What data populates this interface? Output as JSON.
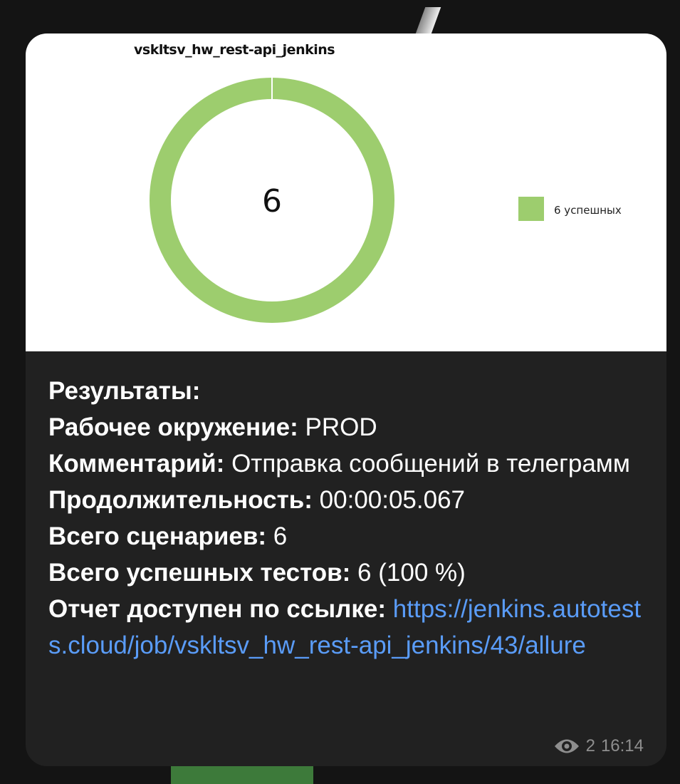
{
  "message": {
    "lines": [
      {
        "label": "Результаты:",
        "value": ""
      },
      {
        "label": "Рабочее окружение:",
        "value": " PROD"
      },
      {
        "label": "Комментарий:",
        "value": " Отправка сообщений в телеграмм"
      },
      {
        "label": "Продолжительность:",
        "value": " 00:00:05.067"
      },
      {
        "label": "Всего сценариев:",
        "value": " 6"
      },
      {
        "label": "Всего успешных тестов:",
        "value": " 6 (100 %)"
      },
      {
        "label": "Отчет доступен по ссылке:",
        "value": " "
      }
    ],
    "link": "https://jenkins.autotests.cloud/job/vskltsv_hw_rest-api_jenkins/43/allure",
    "views": "2",
    "time": "16:14",
    "link_color": "#5a9cf8"
  },
  "chart_data": {
    "type": "pie",
    "title": "vskltsv_hw_rest-api_jenkins",
    "center_label": "6",
    "series": [
      {
        "name": "6 успешных",
        "value": 6,
        "color": "#9dcd6e"
      }
    ],
    "legend_position": "right"
  }
}
